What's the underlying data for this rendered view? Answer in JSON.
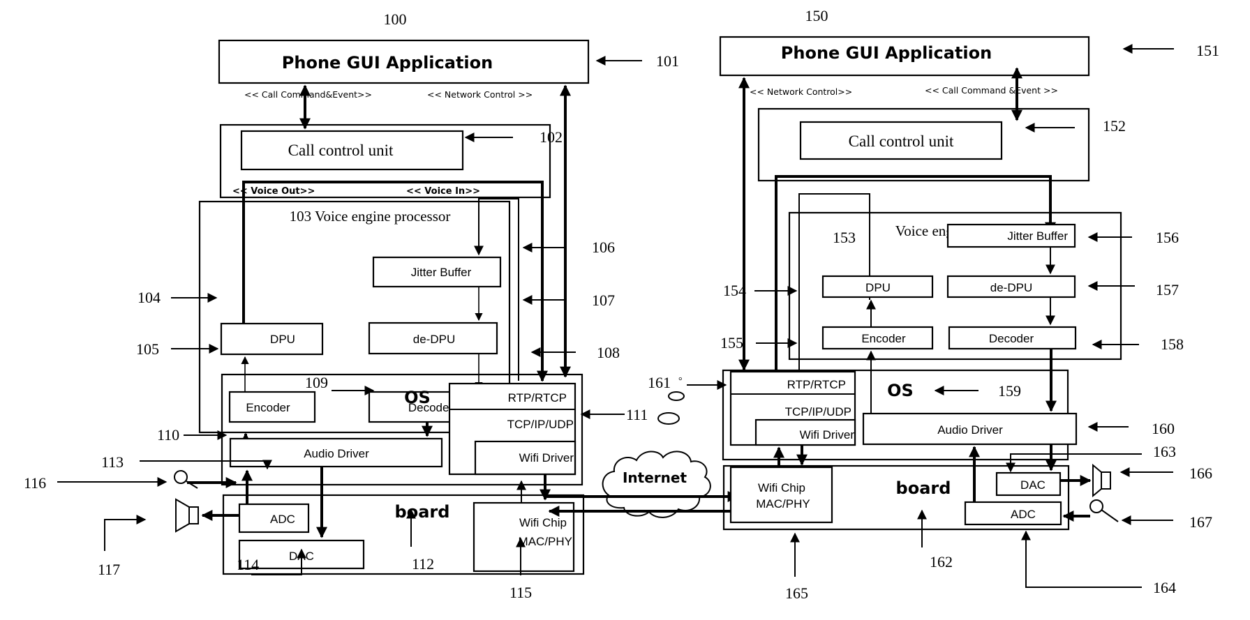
{
  "figure": {
    "left_device": {
      "ref_device": "100",
      "gui_app": {
        "label": "Phone GUI Application",
        "ref": "101"
      },
      "stereotypes": {
        "call_cmd": "<< Call Command&Event>>",
        "net_ctrl": "<< Network Control >>",
        "voice_out": "<< Voice Out>>",
        "voice_in": "<< Voice In>>"
      },
      "call_control": {
        "label": "Call control unit",
        "ref": "102"
      },
      "voice_engine": {
        "label": "103 Voice engine processor"
      },
      "dpu": {
        "label": "DPU",
        "ref": "104"
      },
      "encoder": {
        "label": "Encoder",
        "ref": "105"
      },
      "jitter_buffer": {
        "label": "Jitter Buffer",
        "ref": "106"
      },
      "de_dpu": {
        "label": "de-DPU",
        "ref": "107"
      },
      "decoder": {
        "label": "Decoder",
        "ref": "108"
      },
      "os": {
        "label": "OS",
        "ref": "109"
      },
      "audio_driver": {
        "label": "Audio Driver",
        "ref": "110"
      },
      "net_stack": {
        "rtp": "RTP/RTCP",
        "tcp": "TCP/IP/UDP",
        "wifi_driver": "Wifi Driver",
        "ref": "111"
      },
      "board": {
        "label": "board",
        "ref": "112"
      },
      "ref_113": "113",
      "adc": {
        "label": "ADC",
        "ref": "114"
      },
      "dac": {
        "label": "DAC"
      },
      "wifi_chip": {
        "line1": "Wifi Chip",
        "line2": "MAC/PHY",
        "ref": "115"
      },
      "mic": {
        "ref": "116"
      },
      "speaker": {
        "ref": "117"
      }
    },
    "right_device": {
      "ref_device": "150",
      "gui_app": {
        "label": "Phone GUI Application",
        "ref": "151"
      },
      "stereotypes": {
        "net_ctrl": "<< Network Control>>",
        "call_cmd": "<< Call Command &Event >>"
      },
      "call_control": {
        "label": "Call control unit",
        "ref": "152"
      },
      "voice_engine": {
        "label": "Voice engine processor",
        "ref": "153"
      },
      "dpu": {
        "label": "DPU",
        "ref": "154"
      },
      "encoder": {
        "label": "Encoder",
        "ref": "155"
      },
      "jitter_buffer": {
        "label": "Jitter Buffer",
        "ref": "156"
      },
      "de_dpu": {
        "label": "de-DPU",
        "ref": "157"
      },
      "decoder": {
        "label": "Decoder",
        "ref": "158"
      },
      "os": {
        "label": "OS",
        "ref": "159"
      },
      "audio_driver": {
        "label": "Audio Driver",
        "ref": "160"
      },
      "net_stack": {
        "rtp": "RTP/RTCP",
        "tcp": "TCP/IP/UDP",
        "wifi_driver": "Wifi Driver",
        "ref": "161"
      },
      "board": {
        "label": "board",
        "ref": "162"
      },
      "ref_163": "163",
      "adc": {
        "label": "ADC",
        "ref": "164"
      },
      "dac": {
        "label": "DAC"
      },
      "wifi_chip": {
        "line1": "Wifi Chip",
        "line2": "MAC/PHY",
        "ref": "165"
      },
      "speaker": {
        "ref": "166"
      },
      "mic": {
        "ref": "167"
      }
    },
    "network": {
      "label": "Internet"
    }
  }
}
